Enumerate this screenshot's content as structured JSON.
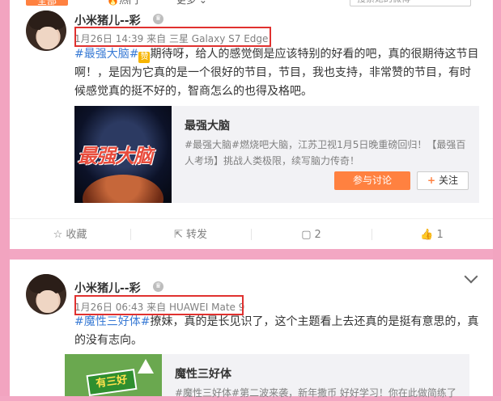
{
  "tabs": {
    "all": "全部",
    "hot": "🔥热门",
    "more": "更多 ⌄"
  },
  "search": {
    "placeholder": "搜索她的微博"
  },
  "post1": {
    "username": "小米猪儿--彩",
    "time": "1月26日 14:39",
    "from": "来自",
    "device": "三星 Galaxy S7 Edge",
    "hashtag": "#最强大脑#",
    "emoji": "赞",
    "text_after": "期待呀，给人的感觉倒是应该特别的好看的吧，真的很期待这节目啊！，是因为它真的是一个很好的节目，节目，我也支持，非常赞的节目，有时候感觉真的挺不好的，智商怎么的也得及格吧。",
    "topic": {
      "image_text": "最强大脑",
      "title": "最强大脑",
      "desc": "#最强大脑#燃烧吧大脑，江苏卫视1月5日晚重磅回归！【最强百人考场】挑战人类极限，续写脑力传奇！",
      "join": "参与讨论",
      "follow": "关注"
    },
    "actions": {
      "fav": "收藏",
      "forward": "转发",
      "comment": "2",
      "like": "1"
    }
  },
  "post2": {
    "username": "小米猪儿--彩",
    "time": "1月26日 06:43",
    "from": "来自",
    "device": "HUAWEI Mate 9",
    "hashtag": "#魔性三好体#",
    "text_after": "撩妹，真的是长见识了，这个主题看上去还真的是挺有意思的，真的没有志向。",
    "topic": {
      "image_text": "有三好",
      "title": "魔性三好体",
      "desc": "#魔性三好体#第二波来袭，新年撒币 好好学习！你在此做简练了"
    }
  },
  "colors": {
    "accent": "#ff8140",
    "highlight_box": "#e0312f",
    "background": "#f3a7c3"
  }
}
